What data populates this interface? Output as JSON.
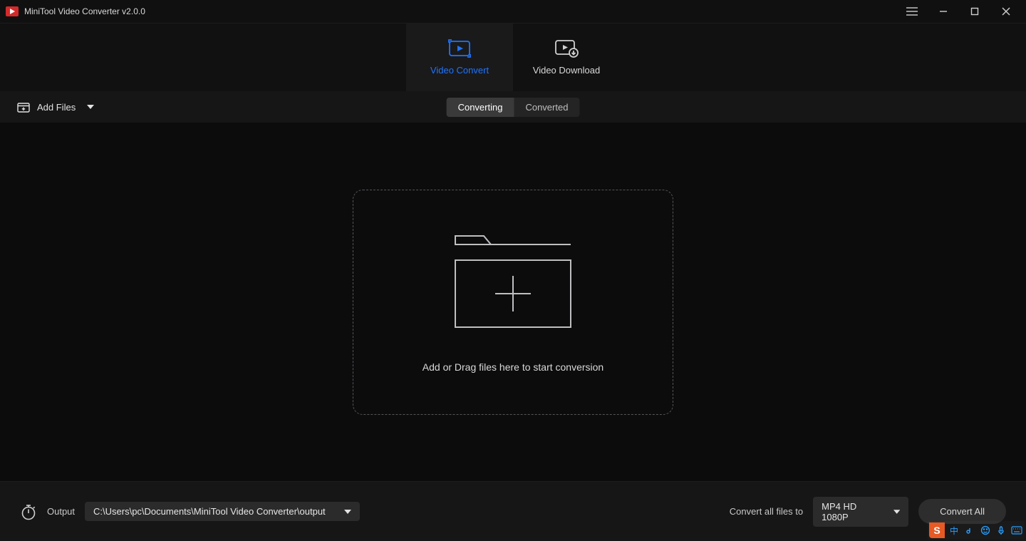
{
  "app": {
    "title": "MiniTool Video Converter v2.0.0"
  },
  "modes": {
    "convert": "Video Convert",
    "download": "Video Download"
  },
  "toolbar": {
    "add_files": "Add Files",
    "seg_converting": "Converting",
    "seg_converted": "Converted"
  },
  "dropzone": {
    "hint": "Add or Drag files here to start conversion"
  },
  "footer": {
    "output_label": "Output",
    "output_path": "C:\\Users\\pc\\Documents\\MiniTool Video Converter\\output",
    "convert_all_label": "Convert all files to",
    "format_value": "MP4 HD 1080P",
    "convert_all_btn": "Convert All"
  },
  "ime": {
    "badge": "S",
    "lang": "中"
  }
}
